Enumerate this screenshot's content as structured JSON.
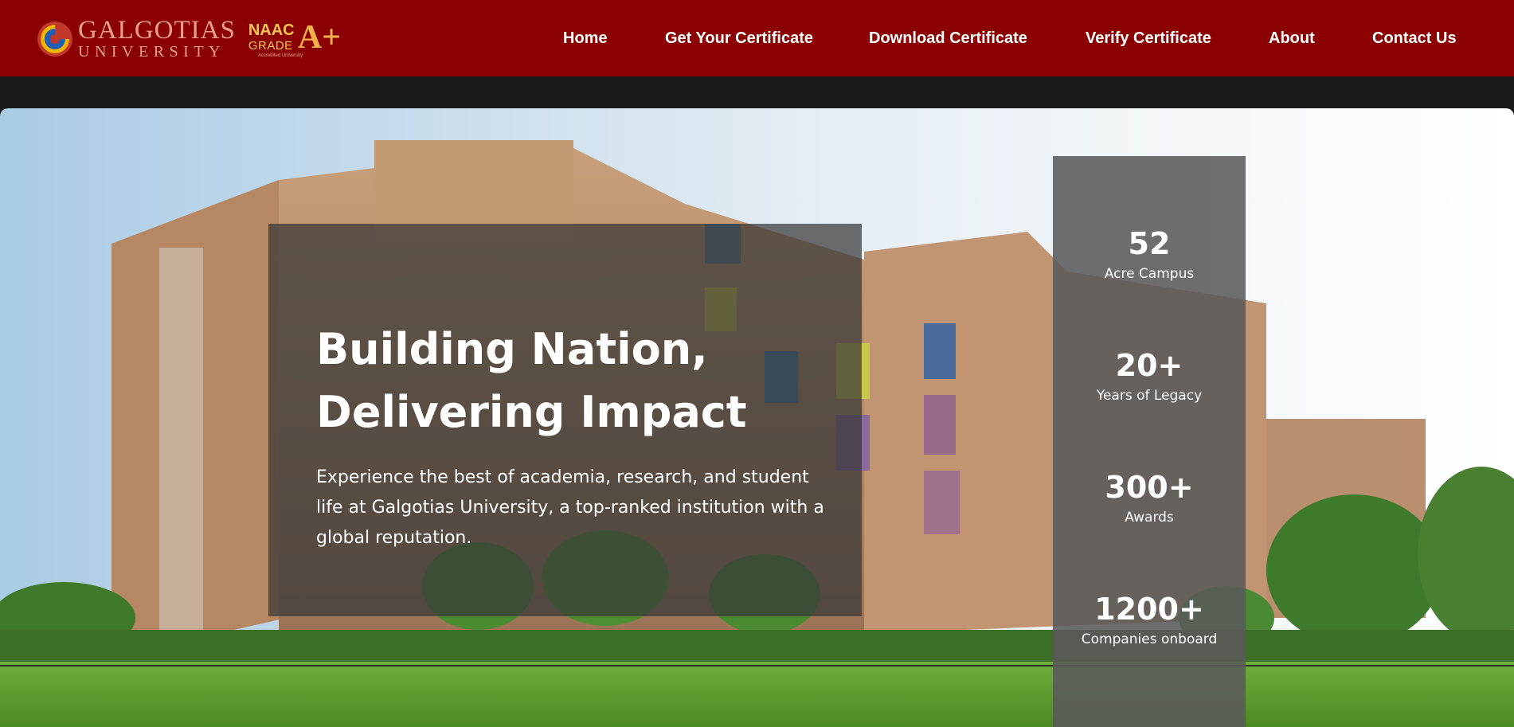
{
  "header": {
    "logo_line1": "GALGOTIAS",
    "logo_line2": "UNIVERSITY",
    "naac_line1": "NAAC",
    "naac_line2": "GRADE",
    "naac_grade": "A+",
    "naac_caption": "Accredited University",
    "nav": [
      {
        "label": "Home"
      },
      {
        "label": "Get Your Certificate"
      },
      {
        "label": "Download Certificate"
      },
      {
        "label": "Verify Certificate"
      },
      {
        "label": "About"
      },
      {
        "label": "Contact Us"
      }
    ]
  },
  "hero": {
    "title_line1": "Building Nation,",
    "title_line2": "Delivering Impact",
    "description": "Experience the best of academia, research, and student life at Galgotias University, a top-ranked institution with a global reputation."
  },
  "stats": [
    {
      "value": "52",
      "label": "Acre Campus"
    },
    {
      "value": "20+",
      "label": "Years of Legacy"
    },
    {
      "value": "300+",
      "label": "Awards"
    },
    {
      "value": "1200+",
      "label": "Companies onboard"
    }
  ],
  "colors": {
    "navbar": "#8b0000",
    "page_background": "#1a1a1a",
    "hero_card": "#373737",
    "stats_card": "#5a5a5a"
  }
}
